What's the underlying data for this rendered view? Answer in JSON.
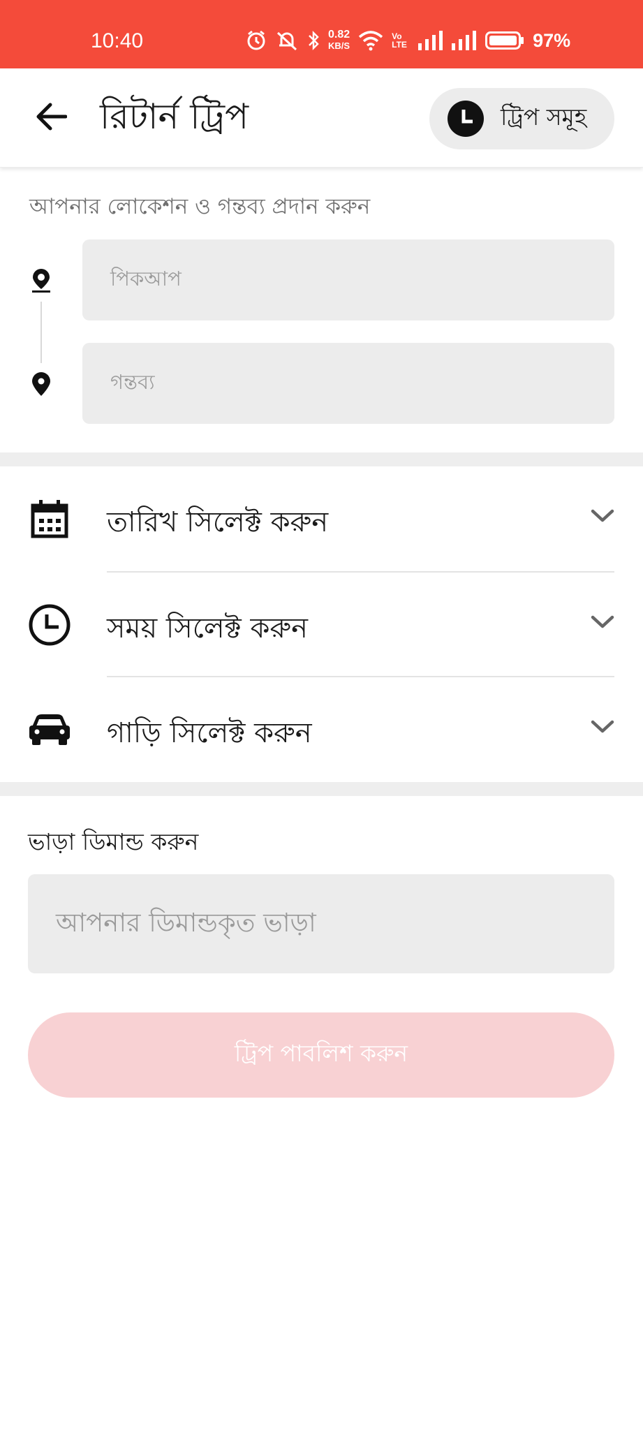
{
  "status_bar": {
    "time": "10:40",
    "net_speed_value": "0.82",
    "net_speed_unit": "KB/S",
    "volte_top": "Vo",
    "volte_bottom": "LTE",
    "battery_percent": "97%",
    "color": "#f44b3a",
    "icons": [
      "alarm-icon",
      "mute-icon",
      "bluetooth-icon",
      "wifi-icon",
      "signal-icon",
      "signal-icon",
      "battery-icon"
    ]
  },
  "app_bar": {
    "title": "রিটার্ন ট্রিপ",
    "trips_button_label": "ট্রিপ সমূহ",
    "back_icon": "arrow-left-icon",
    "trips_icon": "clock-icon"
  },
  "location": {
    "caption": "আপনার লোকেশন ও গন্তব্য প্রদান করুন",
    "pickup_placeholder": "পিকআপ",
    "destination_placeholder": "গন্তব্য"
  },
  "selects": {
    "date_label": "তারিখ সিলেক্ট করুন",
    "time_label": "সময় সিলেক্ট করুন",
    "car_label": "গাড়ি সিলেক্ট করুন"
  },
  "fare": {
    "caption": "ভাড়া ডিমান্ড করুন",
    "placeholder": "আপনার ডিমান্ডকৃত ভাড়া"
  },
  "publish": {
    "label": "ট্রিপ পাবলিশ করুন",
    "color": "#f8d1d3"
  }
}
